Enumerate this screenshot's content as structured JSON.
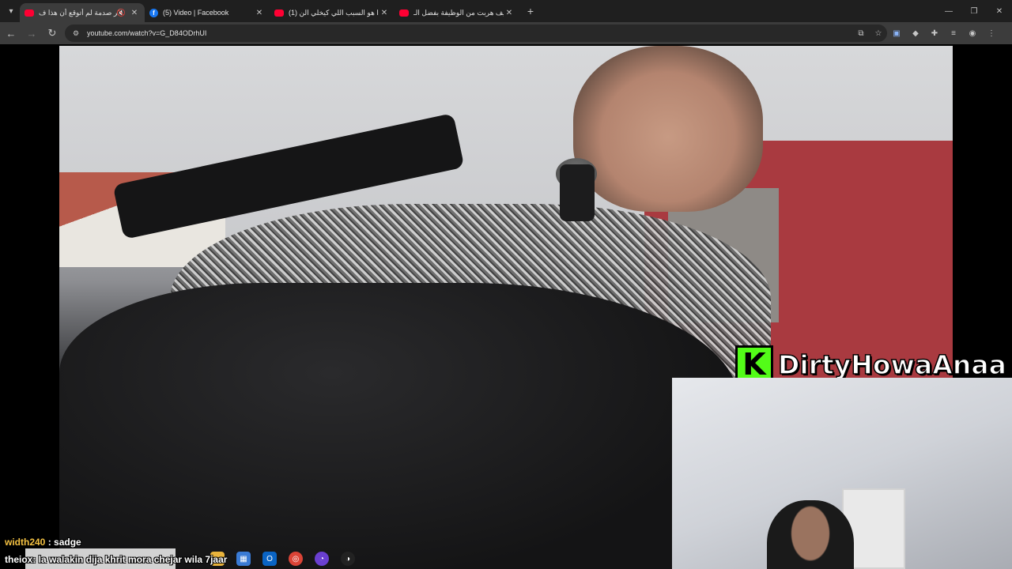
{
  "browser": {
    "tabs": [
      {
        "title": "أكبر صدمة لم أتوقع أن هذا ف",
        "favicon": "youtube-icon",
        "active": true,
        "muted": true
      },
      {
        "title": "(5) Video | Facebook",
        "favicon": "facebook-icon",
        "active": false
      },
      {
        "title": "(1) هذا هو السبب اللي كيخلي الن",
        "favicon": "youtube-icon",
        "active": false
      },
      {
        "title": "كيف هربت من الوظيفة بفضل الـ",
        "favicon": "youtube-icon",
        "active": false
      }
    ],
    "url": "youtube.com/watch?v=G_D84ODrhUI"
  },
  "stream": {
    "streamer_name": "DirtyHowaAnaa",
    "logo_letter": "K"
  },
  "chat": [
    {
      "user": "width240",
      "separator": ":",
      "message": "sadge"
    },
    {
      "line": "theiox: la walakin dija khrit mora chejar wila 7jaar"
    }
  ],
  "colors": {
    "kick_green": "#53fc18",
    "tab_bar": "#1f1f1f",
    "toolbar": "#3c3c3c",
    "youtube_red": "#ff0033",
    "facebook_blue": "#1877f2"
  }
}
